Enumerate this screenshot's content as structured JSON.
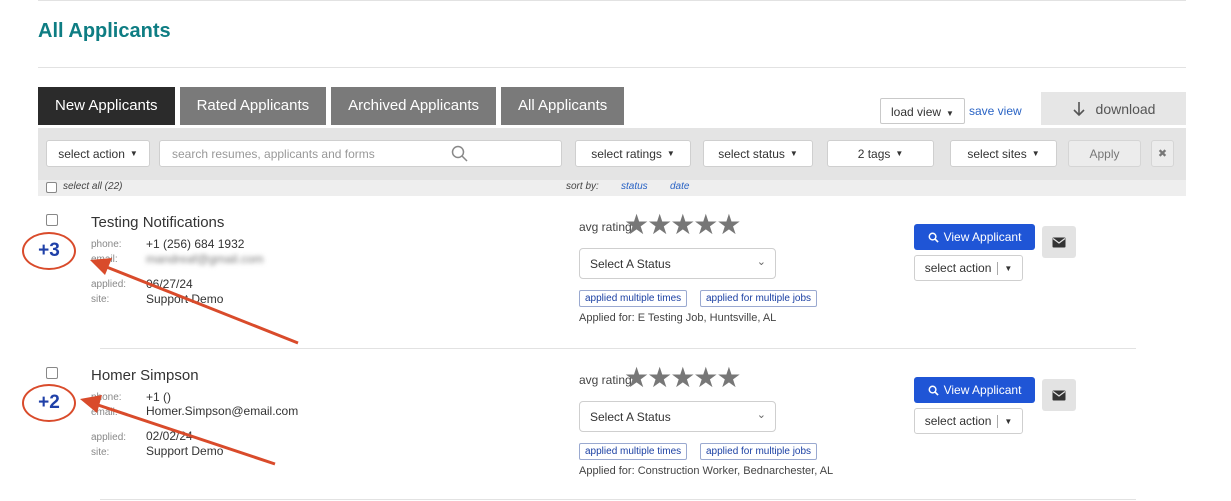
{
  "page": {
    "title": "All Applicants"
  },
  "tabs": [
    {
      "label": "New Applicants",
      "active": true
    },
    {
      "label": "Rated Applicants",
      "active": false
    },
    {
      "label": "Archived Applicants",
      "active": false
    },
    {
      "label": "All Applicants",
      "active": false
    }
  ],
  "views": {
    "load_view_label": "load view",
    "save_view_label": "save view",
    "download_label": "download"
  },
  "toolbar": {
    "select_action_label": "select action",
    "search_placeholder": "search resumes, applicants and forms",
    "select_ratings_label": "select ratings",
    "select_status_label": "select status",
    "tags_label": "2 tags",
    "select_sites_label": "select sites",
    "apply_label": "Apply",
    "clear_label": "✖"
  },
  "subbar": {
    "select_all_label": "select all (22)",
    "sort_by_label": "sort by:",
    "sort_status_label": "status",
    "sort_date_label": "date"
  },
  "labels": {
    "phone": "phone:",
    "email": "email:",
    "applied": "applied:",
    "site": "site:",
    "avg_rating": "avg rating:",
    "stars": "★★★★★",
    "status_placeholder": "Select A Status",
    "view_applicant": "View Applicant",
    "row_action": "select action"
  },
  "applicants": [
    {
      "name": "Testing Notifications",
      "phone": "+1 (256) 684 1932",
      "email": "mandreaf@gmail.com",
      "applied": "06/27/24",
      "site": "Support Demo",
      "rating": 0,
      "tags": [
        "applied multiple times",
        "applied for multiple jobs"
      ],
      "applied_for": "Applied for: E Testing Job, Huntsville, AL",
      "badge": "+3"
    },
    {
      "name": "Homer Simpson",
      "phone": "+1 ()",
      "email": "Homer.Simpson@email.com",
      "applied": "02/02/24",
      "site": "Support Demo",
      "rating": 0,
      "tags": [
        "applied multiple times",
        "applied for multiple jobs"
      ],
      "applied_for": "Applied for: Construction Worker, Bednarchester, AL",
      "badge": "+2"
    }
  ],
  "colors": {
    "brand_title": "#0e7d83",
    "primary_button": "#1f55d6",
    "annotation": "#d94b2b",
    "link": "#2a64c5"
  }
}
